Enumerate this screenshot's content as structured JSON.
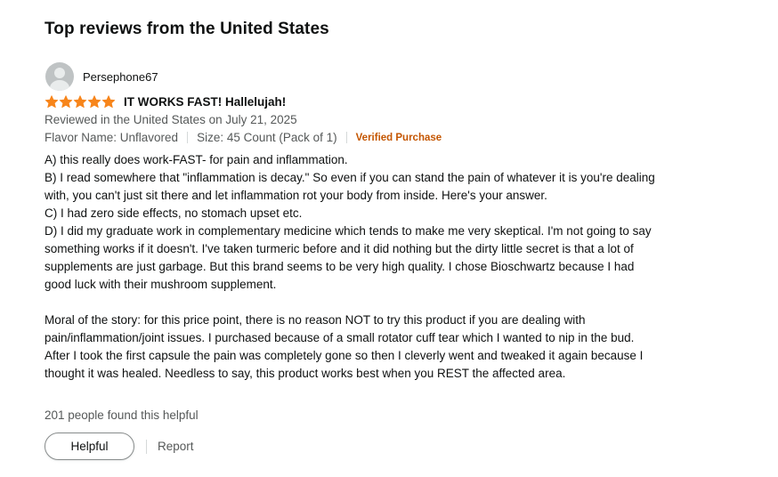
{
  "section": {
    "title": "Top reviews from the United States"
  },
  "review": {
    "profile_name": "Persephone67",
    "rating": 5,
    "rating_max": 5,
    "star_color": "#f7851b",
    "title": "IT WORKS FAST! Hallelujah!",
    "reviewed_in": "Reviewed in the United States on July 21, 2025",
    "flavor": "Flavor Name: Unflavored",
    "size": "Size: 45 Count (Pack of 1)",
    "verified": "Verified Purchase",
    "verified_color": "#c45500",
    "body": [
      "A) this really does work-FAST- for pain and inflammation.",
      "B) I read somewhere that \"inflammation is decay.\" So even if you can stand the pain of whatever it is you're dealing with, you can't just sit there and let inflammation rot your body from inside. Here's your answer.",
      "C) I had zero side effects, no stomach upset etc.",
      "D) I did my graduate work in complementary medicine which tends to make me very skeptical. I'm not going to say something works if it doesn't. I've taken turmeric before and it did nothing but the dirty little secret is that a lot of supplements are just garbage. But this brand seems to be very high quality. I chose Bioschwartz because I had good luck with their mushroom supplement.",
      "",
      "Moral of the story: for this price point, there is no reason NOT to try this product if you are dealing with pain/inflammation/joint issues. I purchased because of a small rotator cuff tear which I wanted to nip in the bud. After I took the first capsule the pain was completely gone so then I cleverly went and tweaked it again because I thought it was healed. Needless to say, this product works best when you REST the affected area."
    ],
    "helpful_count": "201 people found this helpful",
    "helpful_label": "Helpful",
    "report_label": "Report"
  }
}
